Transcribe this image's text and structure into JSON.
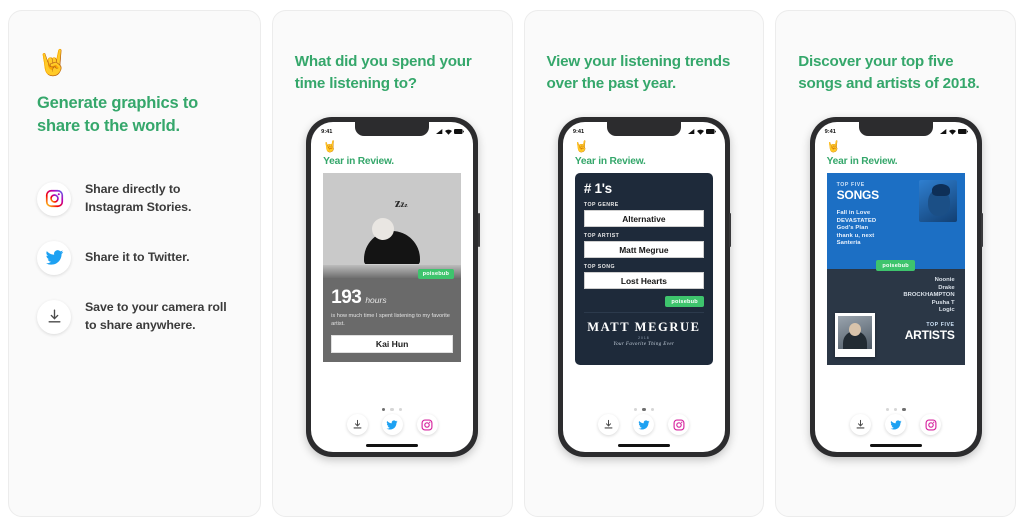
{
  "panels": [
    {
      "type": "features",
      "logo_icon": "rock-on-hand-icon",
      "logo_glyph": "🤘",
      "headline": "Generate graphics to share to the world.",
      "features": [
        {
          "icon": "instagram-icon",
          "text": "Share directly to Instagram Stories."
        },
        {
          "icon": "twitter-icon",
          "text": "Share it to Twitter."
        },
        {
          "icon": "download-icon",
          "text": "Save to your camera roll to share anywhere."
        }
      ]
    },
    {
      "type": "phone",
      "headline": "What did you spend your time listening to?",
      "phone": {
        "status_time": "9:41",
        "logo_glyph": "🤘",
        "app_title": "Year in Review.",
        "card": {
          "kind": "hours",
          "badge": "poisebub",
          "hours_value": "193",
          "hours_unit": "hours",
          "description": "is how much time I spent listening to my favorite artist.",
          "artist_field": "Kai Hun",
          "photo_caption": "z z z"
        },
        "dots": {
          "count": 3,
          "active": 0
        },
        "share_buttons": [
          "download-icon",
          "twitter-icon",
          "instagram-icon"
        ]
      }
    },
    {
      "type": "phone",
      "headline": "View your listening trends over the past year.",
      "phone": {
        "status_time": "9:41",
        "logo_glyph": "🤘",
        "app_title": "Year in Review.",
        "card": {
          "kind": "number-ones",
          "title": "# 1's",
          "badge": "poisebub",
          "rows": [
            {
              "label": "TOP GENRE",
              "value": "Alternative"
            },
            {
              "label": "TOP ARTIST",
              "value": "Matt Megrue"
            },
            {
              "label": "TOP SONG",
              "value": "Lost Hearts"
            }
          ],
          "banner_name": "MATT MEGRUE",
          "banner_sub1": "2018",
          "banner_sub2": "Your Favorite Thing Ever"
        },
        "dots": {
          "count": 3,
          "active": 1
        },
        "share_buttons": [
          "download-icon",
          "twitter-icon",
          "instagram-icon"
        ]
      }
    },
    {
      "type": "phone",
      "headline": "Discover your top five songs and artists of 2018.",
      "phone": {
        "status_time": "9:41",
        "logo_glyph": "🤘",
        "app_title": "Year in Review.",
        "card": {
          "kind": "top-five",
          "badge": "poisebub",
          "songs_kicker": "TOP FIVE",
          "songs_heading": "SONGS",
          "songs": [
            "Fall in Love",
            "DEVASTATED",
            "God's Plan",
            "thank u, next",
            "Santeria"
          ],
          "artists_kicker": "TOP FIVE",
          "artists_heading": "ARTISTS",
          "artists": [
            "Noonie",
            "Drake",
            "BROCKHAMPTON",
            "Pusha T",
            "Logic"
          ]
        },
        "dots": {
          "count": 3,
          "active": 2
        },
        "share_buttons": [
          "download-icon",
          "twitter-icon",
          "instagram-icon"
        ]
      }
    }
  ],
  "colors": {
    "brand_green": "#35a76b",
    "badge_green": "#3ec46d",
    "panel_bg": "#fafafa",
    "card_navy": "#1e2a3a",
    "card_blue": "#1c6fc4",
    "card_slate": "#2b3746",
    "twitter_blue": "#1da1f2"
  }
}
